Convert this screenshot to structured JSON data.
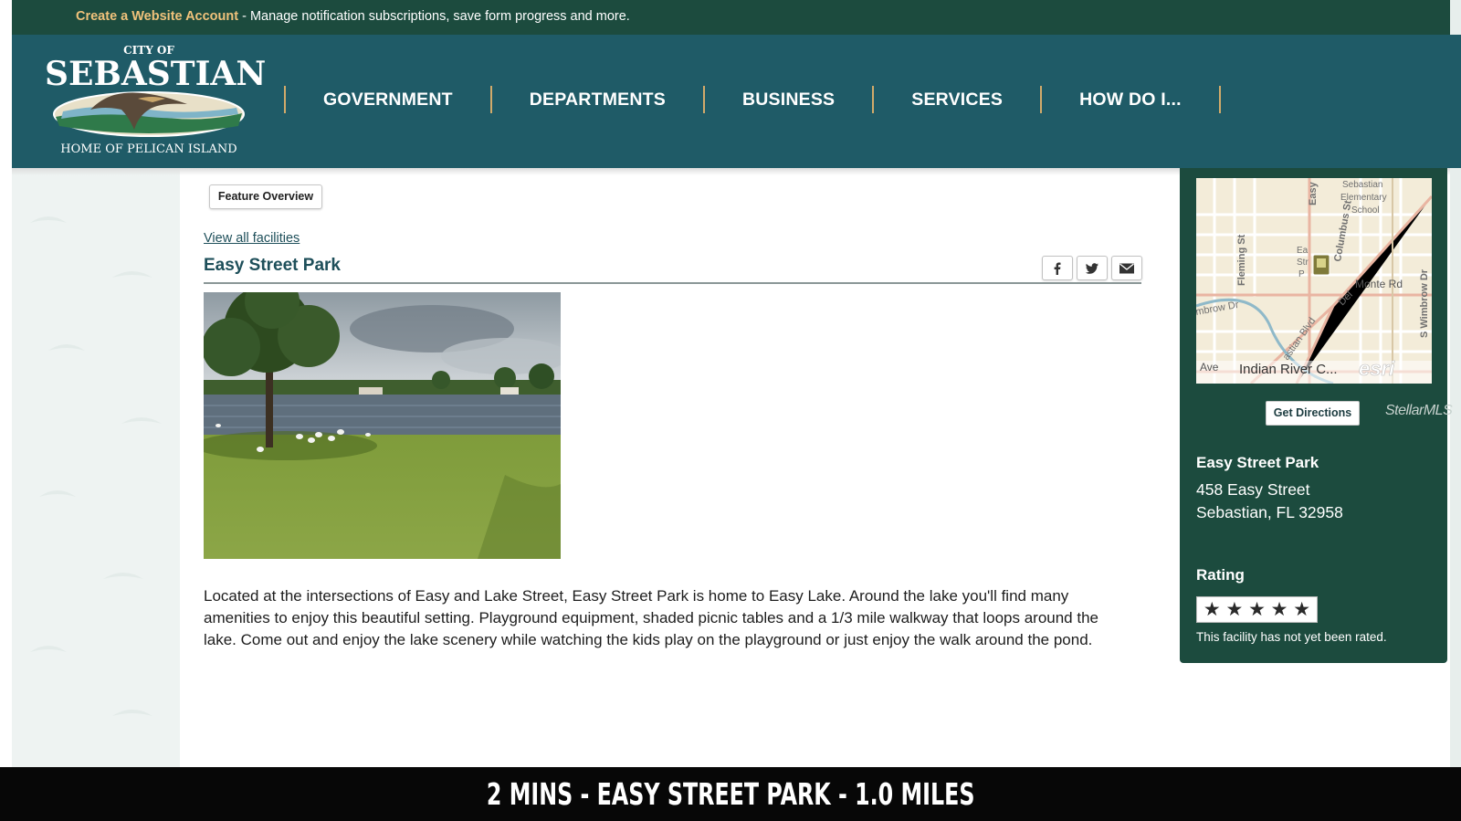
{
  "topbar": {
    "account_link": "Create a Website Account",
    "message": " - Manage notification subscriptions, save form progress and more."
  },
  "logo": {
    "city_of": "CITY OF",
    "name": "SEBASTIAN",
    "tagline": "HOME OF PELICAN ISLAND"
  },
  "nav": {
    "items": [
      "GOVERNMENT",
      "DEPARTMENTS",
      "BUSINESS",
      "SERVICES",
      "HOW DO I..."
    ]
  },
  "content": {
    "feature_tab": "Feature Overview",
    "view_all": "View all facilities",
    "title": "Easy Street Park",
    "description": "Located at the intersections of Easy and Lake Street, Easy Street Park is home to Easy Lake. Around the lake you'll find many amenities to enjoy this beautiful setting. Playground equipment, shaded picnic tables and a 1/3 mile walkway that loops around the lake. Come out and enjoy the lake scenery while watching the kids play on the playground or just enjoy the walk around the pond."
  },
  "share": {
    "icons": [
      "facebook-icon",
      "twitter-icon",
      "email-icon"
    ]
  },
  "map": {
    "labels": {
      "school": "Sebastian Elementary School",
      "fleming": "Fleming St",
      "columbus": "Columbus St",
      "easy": "Easy",
      "monte": "Monte Rd",
      "del": "Del",
      "wimbrow": "S Wimbrow Dr",
      "embrow": "mbrow Dr",
      "sebastian_blvd": "astian Blvd",
      "ea": "Ea",
      "str": "Str",
      "p": "P",
      "ave": "Ave",
      "indian_river": "Indian River C...",
      "esri": "esri"
    }
  },
  "card": {
    "directions": "Get Directions",
    "watermark": "StellarMLS",
    "name": "Easy Street Park",
    "address1": "458 Easy Street",
    "address2": "Sebastian, FL 32958",
    "rating_heading": "Rating",
    "stars_total": 5,
    "rating_note": "This facility has not yet been rated."
  },
  "caption": "2 MINS - EASY STREET PARK - 1.0 MILES",
  "colors": {
    "topbar": "#1c4b3e",
    "header": "#1f5b67",
    "accent": "#f0c27b",
    "card": "#1c4b3e",
    "title": "#1e4f5a"
  }
}
